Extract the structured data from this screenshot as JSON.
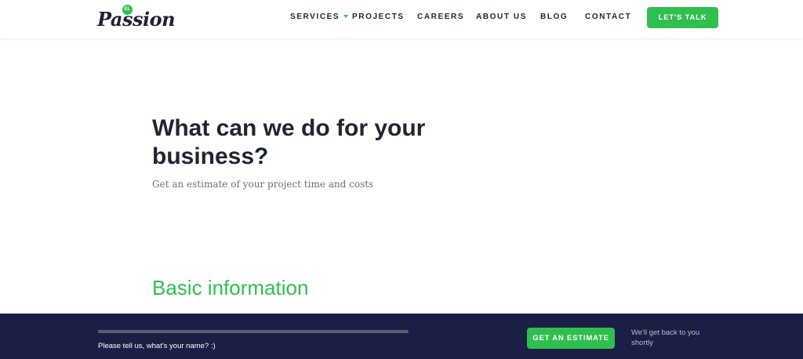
{
  "header": {
    "logo": {
      "badge": "EL",
      "text": "Passion"
    },
    "nav": [
      {
        "label": "SERVICES",
        "has_dropdown": true
      },
      {
        "label": "PROJECTS"
      },
      {
        "label": "CAREERS"
      },
      {
        "label": "ABOUT US"
      },
      {
        "label": "BLOG"
      },
      {
        "label": "CONTACT"
      }
    ],
    "cta_label": "LET'S TALK"
  },
  "hero": {
    "title": "What can we do for your business?",
    "subtitle": "Get an estimate of your project time and costs"
  },
  "form": {
    "section_title": "Basic information"
  },
  "footer": {
    "progress": 0,
    "prompt": "Please tell us, what's your name? :)",
    "estimate_label": "GET AN ESTIMATE",
    "note": "We'll get back to you shortly"
  },
  "colors": {
    "accent": "#2fbf4f",
    "text": "#1f2533",
    "footer_bg": "#1c1f45"
  }
}
